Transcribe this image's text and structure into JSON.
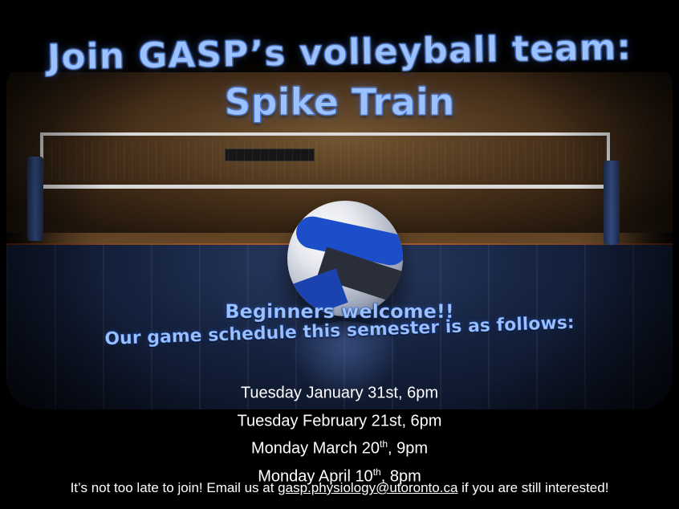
{
  "title": {
    "line1": "Join GASP’s volleyball team:",
    "line2": "Spike Train"
  },
  "subtitle": {
    "line1": "Beginners welcome!!",
    "line2": "Our game schedule this semester is as follows:"
  },
  "schedule": [
    {
      "prefix": "Tuesday January 31st",
      "sup": "",
      "suffix": ", 6pm"
    },
    {
      "prefix": "Tuesday February 21st",
      "sup": "",
      "suffix": ", 6pm"
    },
    {
      "prefix": "Monday March 20",
      "sup": "th",
      "suffix": ", 9pm"
    },
    {
      "prefix": "Monday April 10",
      "sup": "th",
      "suffix": ", 8pm"
    }
  ],
  "footer": {
    "before": "It’s not too late to join! Email us at ",
    "email": "gasp.physiology@utoronto.ca",
    "after": " if you are still interested!"
  },
  "colors": {
    "title": "#9cc1ff",
    "body_text": "#ffffff",
    "background": "#000000"
  }
}
